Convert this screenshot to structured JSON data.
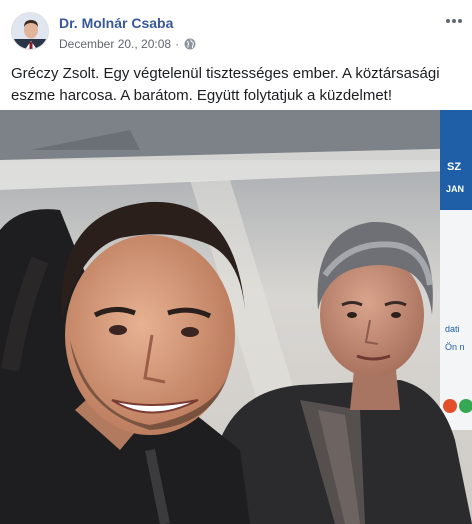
{
  "post": {
    "author": "Dr. Molnár Csaba",
    "timestamp": "December 20., 20:08",
    "separator": "·",
    "privacy_icon": "globe-icon",
    "more_icon": "more-options-icon",
    "text": "Gréczy Zsolt. Egy végtelenül tisztességes ember. A köztársasági eszme harcosa. A barátom. Együtt folytatjuk a küzdelmet!"
  },
  "colors": {
    "author_link": "#385898",
    "meta_text": "#616770",
    "body_text": "#1c1e21",
    "banner_blue": "#1f5fa8"
  },
  "photo": {
    "banner_text": [
      "SZ",
      "JAN",
      "dati",
      "Ön n"
    ]
  }
}
